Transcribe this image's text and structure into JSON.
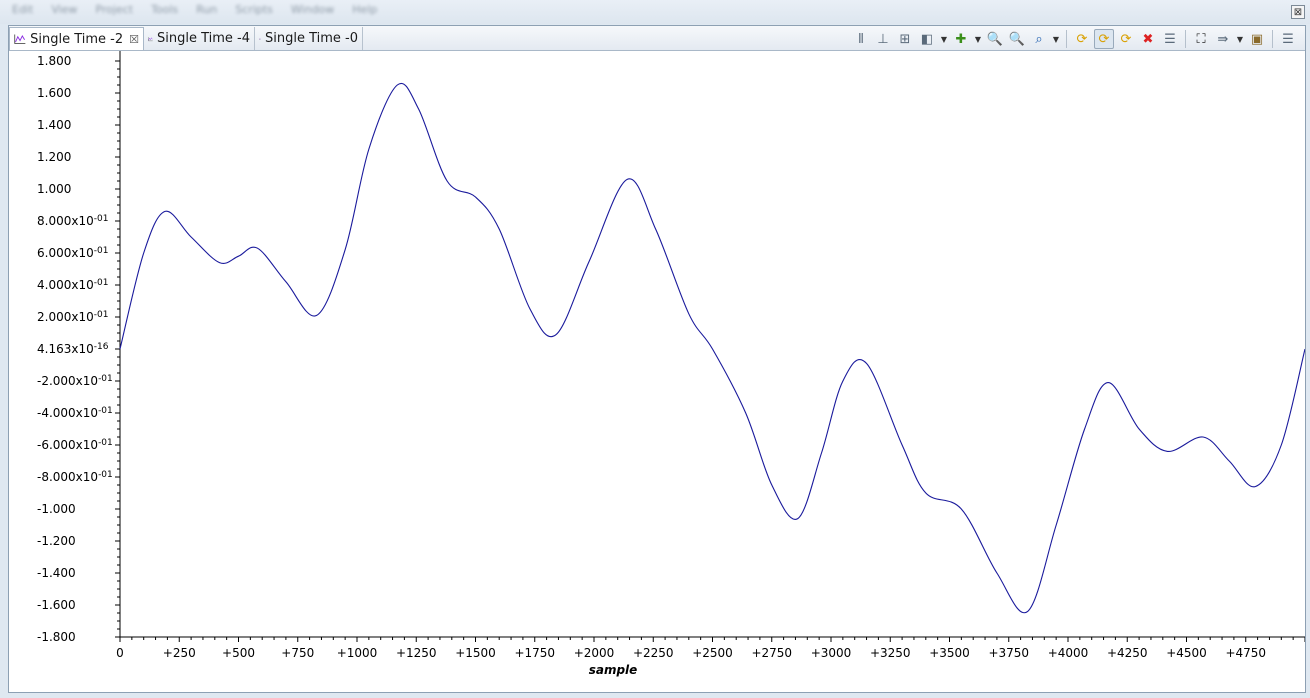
{
  "menu": {
    "items": [
      "Edit",
      "View",
      "Project",
      "Tools",
      "Run",
      "Scripts",
      "Window",
      "Help"
    ]
  },
  "view": {
    "close_symbol": "⊠"
  },
  "tabs": [
    {
      "label": "Single Time -2",
      "active": true,
      "closable": true,
      "icon": "graph-icon"
    },
    {
      "label": "Single Time -4",
      "active": false,
      "closable": false,
      "icon": "graph-icon"
    },
    {
      "label": "Single Time -0",
      "active": false,
      "closable": false,
      "icon": "graph-icon"
    }
  ],
  "toolbar": [
    {
      "name": "align-left-icon",
      "glyph": "⫴"
    },
    {
      "name": "align-center-icon",
      "glyph": "⊥"
    },
    {
      "name": "align-right-icon",
      "glyph": "⊞"
    },
    {
      "name": "marker-icon",
      "glyph": "◧"
    },
    {
      "name": "marker-dropdown-icon",
      "glyph": "▼",
      "dd": true
    },
    {
      "name": "add-star-icon",
      "glyph": "✚"
    },
    {
      "name": "add-star-dropdown-icon",
      "glyph": "▼",
      "dd": true
    },
    {
      "name": "zoom-in-icon",
      "glyph": "🔍"
    },
    {
      "name": "zoom-out-icon",
      "glyph": "🔍"
    },
    {
      "name": "zoom-fit-icon",
      "glyph": "⌕"
    },
    {
      "name": "zoom-dropdown-icon",
      "glyph": "▼",
      "dd": true
    },
    {
      "name": "sep"
    },
    {
      "name": "refresh-icon",
      "glyph": "⟳"
    },
    {
      "name": "continuous-refresh-icon",
      "glyph": "⟳",
      "pressed": true
    },
    {
      "name": "refresh-all-icon",
      "glyph": "⟳"
    },
    {
      "name": "clear-icon",
      "glyph": "✖"
    },
    {
      "name": "properties-icon",
      "glyph": "☰"
    },
    {
      "name": "sep"
    },
    {
      "name": "binoculars-icon",
      "glyph": "⛶"
    },
    {
      "name": "export-icon",
      "glyph": "⇛"
    },
    {
      "name": "export-dropdown-icon",
      "glyph": "▼",
      "dd": true
    },
    {
      "name": "save-icon",
      "glyph": "▣"
    },
    {
      "name": "sep"
    },
    {
      "name": "view-menu-icon",
      "glyph": "☰"
    }
  ],
  "chart_data": {
    "type": "line",
    "xlabel": "sample",
    "xlim": [
      0,
      5000
    ],
    "ylim": [
      -1.8,
      1.8
    ],
    "x_ticks": [
      "0",
      "+250",
      "+500",
      "+750",
      "+1000",
      "+1250",
      "+1500",
      "+1750",
      "+2000",
      "+2250",
      "+2500",
      "+2750",
      "+3000",
      "+3250",
      "+3500",
      "+3750",
      "+4000",
      "+4250",
      "+4500",
      "+4750"
    ],
    "x_tick_values": [
      0,
      250,
      500,
      750,
      1000,
      1250,
      1500,
      1750,
      2000,
      2250,
      2500,
      2750,
      3000,
      3250,
      3500,
      3750,
      4000,
      4250,
      4500,
      4750
    ],
    "y_ticks": [
      {
        "value": 1.8,
        "label": "1.800"
      },
      {
        "value": 1.6,
        "label": "1.600"
      },
      {
        "value": 1.4,
        "label": "1.400"
      },
      {
        "value": 1.2,
        "label": "1.200"
      },
      {
        "value": 1.0,
        "label": "1.000"
      },
      {
        "value": 0.8,
        "mantissa": "8.000x10",
        "exp": "-01"
      },
      {
        "value": 0.6,
        "mantissa": "6.000x10",
        "exp": "-01"
      },
      {
        "value": 0.4,
        "mantissa": "4.000x10",
        "exp": "-01"
      },
      {
        "value": 0.2,
        "mantissa": "2.000x10",
        "exp": "-01"
      },
      {
        "value": 0.0,
        "mantissa": "4.163x10",
        "exp": "-16"
      },
      {
        "value": -0.2,
        "mantissa": "-2.000x10",
        "exp": "-01"
      },
      {
        "value": -0.4,
        "mantissa": "-4.000x10",
        "exp": "-01"
      },
      {
        "value": -0.6,
        "mantissa": "-6.000x10",
        "exp": "-01"
      },
      {
        "value": -0.8,
        "mantissa": "-8.000x10",
        "exp": "-01"
      },
      {
        "value": -1.0,
        "label": "-1.000"
      },
      {
        "value": -1.2,
        "label": "-1.200"
      },
      {
        "value": -1.4,
        "label": "-1.400"
      },
      {
        "value": -1.6,
        "label": "-1.600"
      },
      {
        "value": -1.8,
        "label": "-1.800"
      }
    ],
    "grid": false,
    "series": [
      {
        "color": "#1a1a9c",
        "points": [
          [
            0,
            0.0
          ],
          [
            100,
            0.6
          ],
          [
            190,
            0.86
          ],
          [
            300,
            0.7
          ],
          [
            420,
            0.54
          ],
          [
            500,
            0.58
          ],
          [
            580,
            0.63
          ],
          [
            700,
            0.42
          ],
          [
            830,
            0.21
          ],
          [
            950,
            0.62
          ],
          [
            1050,
            1.25
          ],
          [
            1170,
            1.65
          ],
          [
            1260,
            1.5
          ],
          [
            1380,
            1.05
          ],
          [
            1500,
            0.95
          ],
          [
            1600,
            0.75
          ],
          [
            1730,
            0.25
          ],
          [
            1840,
            0.09
          ],
          [
            1980,
            0.55
          ],
          [
            2140,
            1.06
          ],
          [
            2260,
            0.75
          ],
          [
            2400,
            0.22
          ],
          [
            2500,
            0.0
          ],
          [
            2640,
            -0.4
          ],
          [
            2750,
            -0.85
          ],
          [
            2860,
            -1.06
          ],
          [
            2960,
            -0.65
          ],
          [
            3050,
            -0.2
          ],
          [
            3150,
            -0.09
          ],
          [
            3300,
            -0.6
          ],
          [
            3400,
            -0.9
          ],
          [
            3550,
            -1.0
          ],
          [
            3700,
            -1.4
          ],
          [
            3830,
            -1.64
          ],
          [
            3950,
            -1.1
          ],
          [
            4070,
            -0.5
          ],
          [
            4170,
            -0.21
          ],
          [
            4300,
            -0.5
          ],
          [
            4420,
            -0.64
          ],
          [
            4570,
            -0.55
          ],
          [
            4680,
            -0.7
          ],
          [
            4790,
            -0.86
          ],
          [
            4900,
            -0.6
          ],
          [
            5000,
            0.0
          ]
        ]
      }
    ]
  }
}
